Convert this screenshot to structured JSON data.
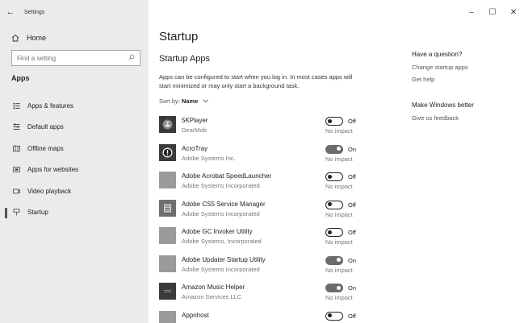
{
  "window": {
    "title": "Settings",
    "back_glyph": "←",
    "minimize_glyph": "–",
    "maximize_glyph": "☐",
    "close_glyph": "✕"
  },
  "sidebar": {
    "home_label": "Home",
    "search_placeholder": "Find a setting",
    "section_heading": "Apps",
    "items": [
      {
        "label": "Apps & features",
        "icon": "apps-features-icon",
        "selected": false
      },
      {
        "label": "Default apps",
        "icon": "default-apps-icon",
        "selected": false
      },
      {
        "label": "Offline maps",
        "icon": "offline-maps-icon",
        "selected": false
      },
      {
        "label": "Apps for websites",
        "icon": "apps-for-websites-icon",
        "selected": false
      },
      {
        "label": "Video playback",
        "icon": "video-playback-icon",
        "selected": false
      },
      {
        "label": "Startup",
        "icon": "startup-icon",
        "selected": true
      }
    ]
  },
  "main": {
    "page_title": "Startup",
    "sub_title": "Startup Apps",
    "description": "Apps can be configured to start when you log in. In most cases apps will start minimized or may only start a background task.",
    "sort_label": "Sort by:",
    "sort_value": "Name",
    "apps": [
      {
        "name": "5KPlayer",
        "publisher": "DearMob",
        "state": "Off",
        "on": false,
        "impact": "No impact",
        "icon": "5kplayer-icon"
      },
      {
        "name": "AcroTray",
        "publisher": "Adobe Systems Inc.",
        "state": "On",
        "on": true,
        "impact": "No impact",
        "icon": "acrotray-icon"
      },
      {
        "name": "Adobe Acrobat SpeedLauncher",
        "publisher": "Adobe Systems Incorporated",
        "state": "Off",
        "on": false,
        "impact": "No impact",
        "icon": "acrobat-speedlauncher-icon"
      },
      {
        "name": "Adobe CS5 Service Manager",
        "publisher": "Adobe Systems Incorporated",
        "state": "Off",
        "on": false,
        "impact": "No impact",
        "icon": "cs5-service-manager-icon"
      },
      {
        "name": "Adobe GC Invoker Utility",
        "publisher": "Adobe Systems, Incorporated",
        "state": "Off",
        "on": false,
        "impact": "No impact",
        "icon": "gc-invoker-icon"
      },
      {
        "name": "Adobe Updater Startup Utility",
        "publisher": "Adobe Systems Incorporated",
        "state": "On",
        "on": true,
        "impact": "No impact",
        "icon": "adobe-updater-icon"
      },
      {
        "name": "Amazon Music Helper",
        "publisher": "Amazon Services LLC",
        "state": "On",
        "on": true,
        "impact": "No impact",
        "icon": "amazon-music-icon"
      },
      {
        "name": "Appnhost",
        "publisher": "",
        "state": "Off",
        "on": false,
        "impact": "",
        "icon": "appnhost-icon"
      }
    ]
  },
  "right_pane": {
    "question_heading": "Have a question?",
    "links": [
      "Change startup apps",
      "Get help"
    ],
    "better_heading": "Make Windows better",
    "feedback_link": "Give us feedback"
  }
}
